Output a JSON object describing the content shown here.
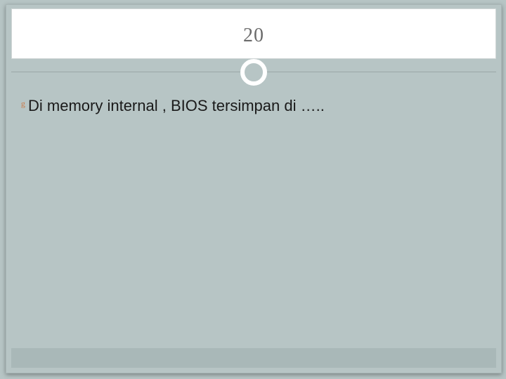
{
  "slide": {
    "number": "20",
    "bullets": [
      {
        "text": "Di memory internal , BIOS tersimpan di ….."
      }
    ]
  }
}
